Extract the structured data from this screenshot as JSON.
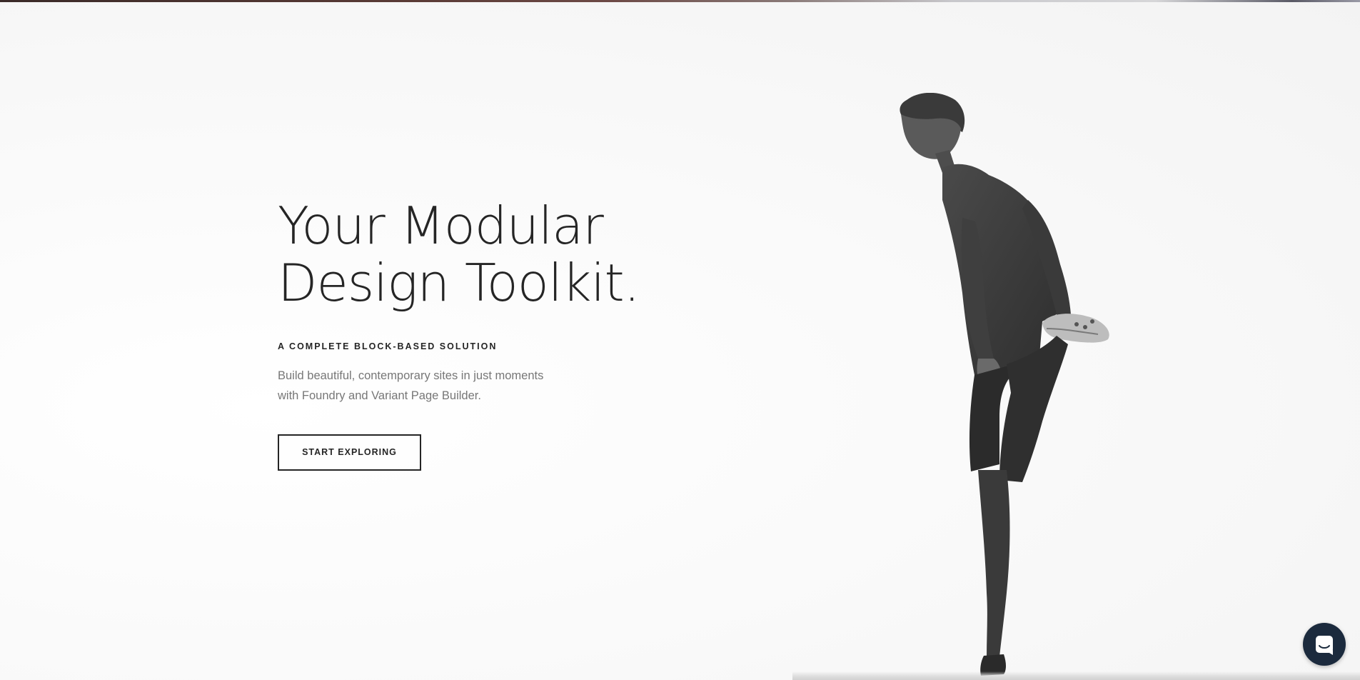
{
  "hero": {
    "headline_line1": "Your Modular",
    "headline_line2": "Design Toolkit.",
    "eyebrow": "A COMPLETE BLOCK-BASED SOLUTION",
    "lead_line1": "Build beautiful, contemporary sites in just moments",
    "lead_line2": "with Foundry and Variant Page Builder.",
    "cta_label": "START EXPLORING"
  },
  "image": {
    "subject": "man stretching leg, black and white photo"
  },
  "chat_widget": {
    "icon": "chat-bubble-icon"
  },
  "colors": {
    "text_dark": "#252525",
    "text_muted": "#777777",
    "chat_bg": "#1b2a3d",
    "background": "#fafafa"
  }
}
